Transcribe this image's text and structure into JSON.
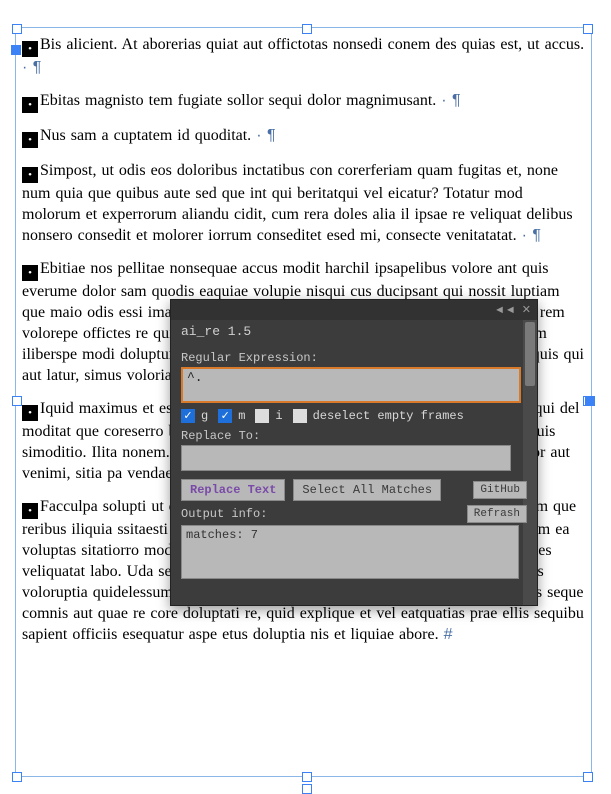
{
  "document": {
    "paragraphs": [
      "Bis alicient. At aborerias quiat aut offictotas nonsedi conem des quias est, ut accus.",
      "Ebitas magnisto tem fugiate sollor sequi dolor magnimusant.",
      "Nus sam a cuptatem id quoditat.",
      "Simpost, ut odis eos doloribus inctatibus con corerferiam quam fugitas et, none num quia que quibus aute sed que int qui beritatqui vel eicatur? Totatur mod molorum et experrorum aliandu cidit, cum rera doles alia il ipsae re veliquat delibus nonsero consedit et molorer iorrum conseditet esed mi, consecte venitatatat.",
      "Ebitiae nos pellitae nonsequae accus modit harchil ipsapelibus volore ant quis everume dolor sam quodis eaquiae volupie nisqui cus ducipsant qui nossit luptiam que maio odis essi imagnat uriatem dus dit enectiis ium a con rectaectatis mos rem volorepe offictes re quidipitatur aut il idigeni modionseque sum quas sequo eum iliberspe modi doluptur, quatur sinis eum repuda nulla cuptatem porios rerem quis qui aut latur, simus voloria qui int volorporatet inctotatem nim in essuntur?",
      "Iquid maximus et esedis nia volorer spediassi comnimus ant fugit, comnim qui del moditat que coreserro blandis ped quam quias di re lande essunt volupta dita quis simoditio. Ilita nonem. Hilitempore sa derorio ea dem auditaquo ditem nis dolor aut venimi, sitia pa vendae nes eruntur?",
      "Facculpa solupti ut quiatecte pratempos prae vendam, accum qui blaut lautem que reribus iliquia ssitaesti voluptur sinctio modit lam, cum ullaccupta qui bea natem ea voluptas sitatiorro modis aut ant pore lam quatur, ommodiciunt officiis et quat es veliquatat labo. Uda serrorepro maximus daeptat fugiaes nempossi dolo blandus voloruptia quidelessum laudani sitatis dolessu ntecti diorro idem rem eum faces seque comnis aut quae re core doluptati re, quid explique et vel eatquatias prae ellis sequibu sapient officiis esequatur aspe etus doluptia nis et liquiae abore."
    ],
    "end_invisible": "#"
  },
  "panel": {
    "title": "ai_re 1.5",
    "regex_label": "Regular Expression:",
    "regex_value": "^.",
    "flags": {
      "g_on": true,
      "g": "g",
      "m_on": true,
      "m": "m",
      "i_on": false,
      "i": "i",
      "deselect_on": false,
      "deselect": "deselect empty frames"
    },
    "replace_label": "Replace To:",
    "replace_value": "",
    "btn_replace": "Replace Text",
    "btn_select": "Select All Matches",
    "btn_github": "GitHub",
    "output_label": "Output info:",
    "btn_refresh": "Refrash",
    "output_text": "matches: 7"
  }
}
